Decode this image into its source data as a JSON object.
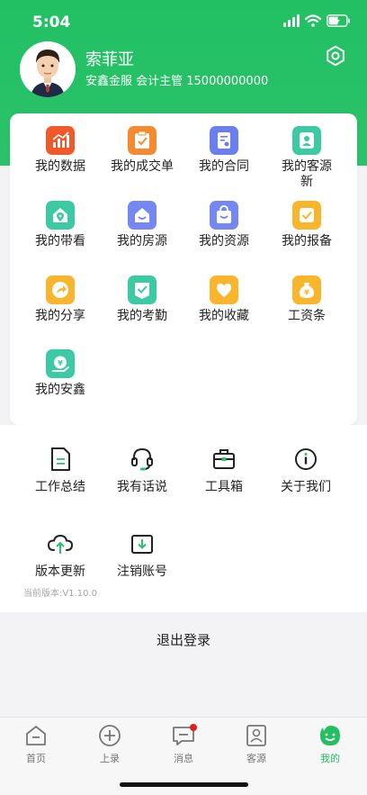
{
  "status": {
    "time": "5:04"
  },
  "profile": {
    "name": "索菲亚",
    "subtitle": "安鑫金服 会计主管 15000000000"
  },
  "colors": {
    "brand": "#22c063",
    "badge": "#e02020"
  },
  "menu": [
    {
      "label": "我的数据",
      "icon": "bar-chart-icon",
      "color": "#f2592a"
    },
    {
      "label": "我的成交单",
      "icon": "clipboard-check-icon",
      "color": "#f58a30"
    },
    {
      "label": "我的合同",
      "icon": "contract-icon",
      "color": "#6b7ef0"
    },
    {
      "label": "我的客源新",
      "icon": "customer-card-icon",
      "color": "#3ccaa5"
    },
    {
      "label": "我的带看",
      "icon": "map-pin-icon",
      "color": "#3ccaa5"
    },
    {
      "label": "我的房源",
      "icon": "house-listing-icon",
      "color": "#7588f2"
    },
    {
      "label": "我的资源",
      "icon": "shopping-bag-icon",
      "color": "#7588f2"
    },
    {
      "label": "我的报备",
      "icon": "report-check-icon",
      "color": "#f9b52c"
    },
    {
      "label": "我的分享",
      "icon": "share-arrow-icon",
      "color": "#f9b52c"
    },
    {
      "label": "我的考勤",
      "icon": "attendance-check-icon",
      "color": "#3ccaa5"
    },
    {
      "label": "我的收藏",
      "icon": "heart-icon",
      "color": "#f9b52c"
    },
    {
      "label": "工资条",
      "icon": "money-bag-icon",
      "color": "#f9b52c"
    },
    {
      "label": "我的安鑫",
      "icon": "yen-coin-icon",
      "color": "#3ccaa5"
    }
  ],
  "tools": [
    {
      "label": "工作总结",
      "icon": "document-icon"
    },
    {
      "label": "我有话说",
      "icon": "headset-icon"
    },
    {
      "label": "工具箱",
      "icon": "toolbox-icon"
    },
    {
      "label": "关于我们",
      "icon": "info-icon"
    },
    {
      "label": "版本更新",
      "icon": "cloud-upload-icon"
    },
    {
      "label": "注销账号",
      "icon": "logout-tray-icon"
    }
  ],
  "version_text": "当前版本:V1.10.0",
  "logout_label": "退出登录",
  "tabs": [
    {
      "label": "首页",
      "icon": "home-icon"
    },
    {
      "label": "上录",
      "icon": "add-circle-icon"
    },
    {
      "label": "消息",
      "icon": "message-icon"
    },
    {
      "label": "客源",
      "icon": "contact-icon"
    },
    {
      "label": "我的",
      "icon": "smile-icon"
    }
  ]
}
